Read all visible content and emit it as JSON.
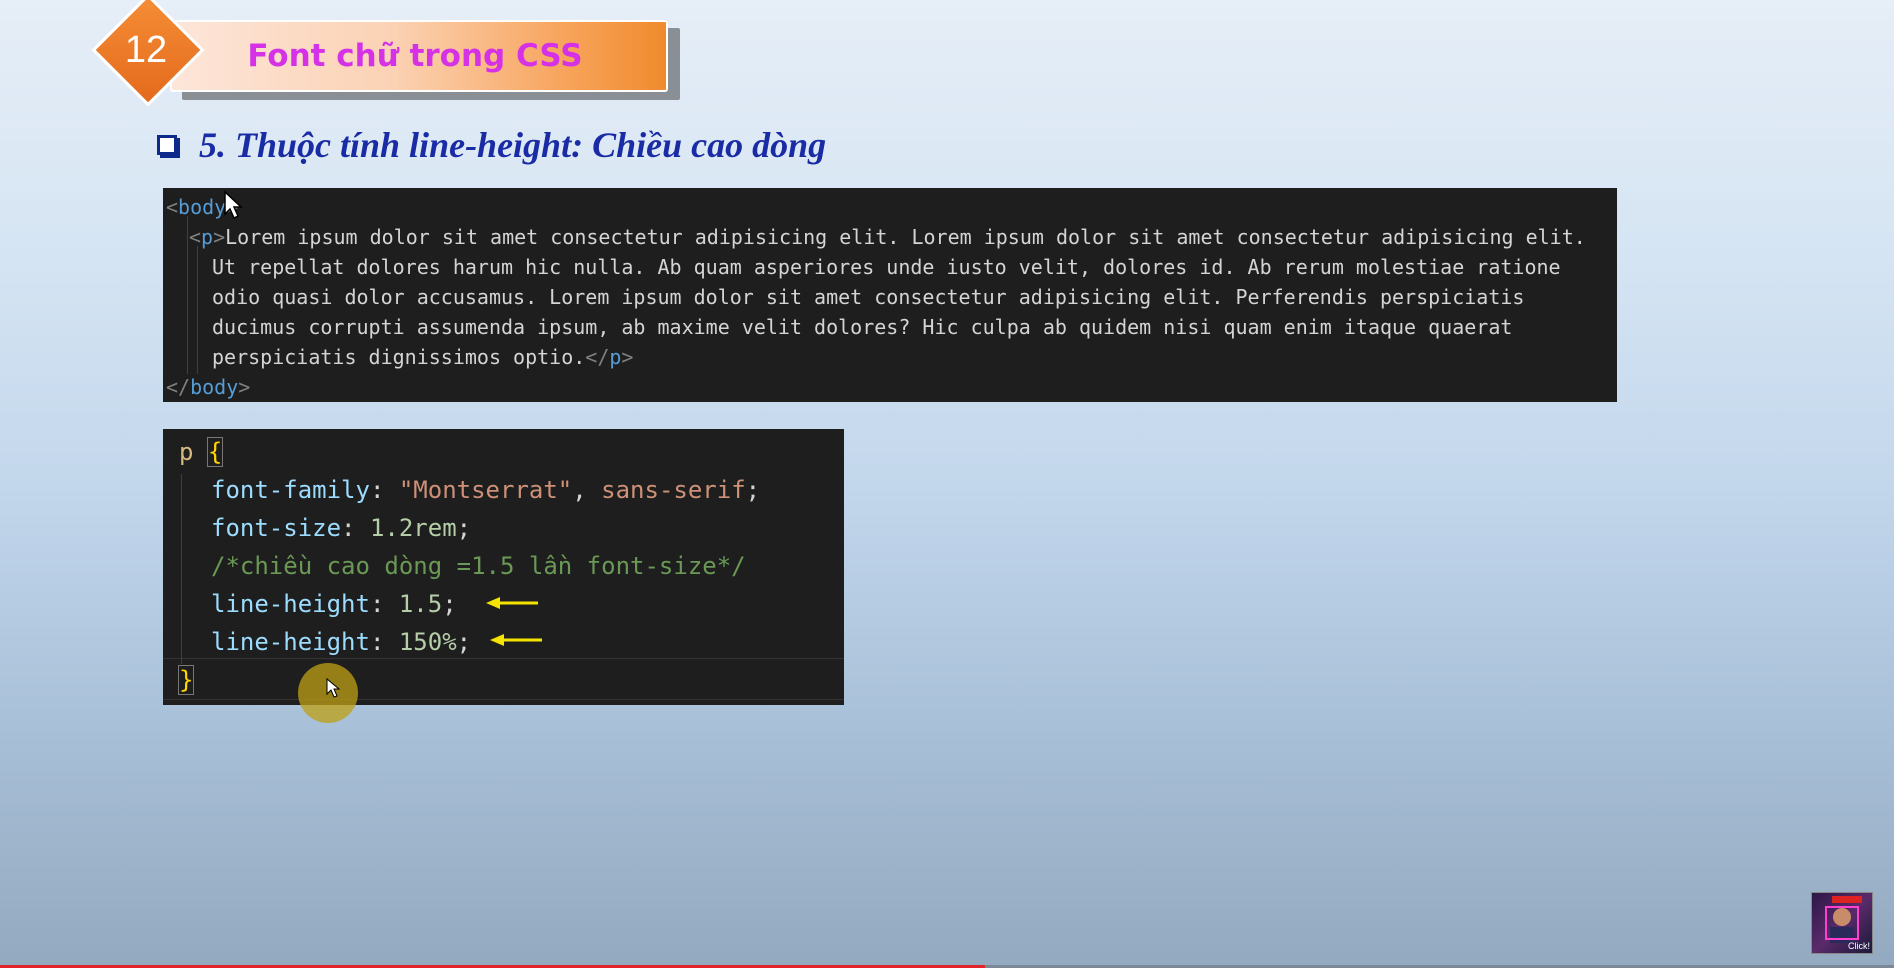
{
  "slide": {
    "badge_number": "12",
    "title": "Font chữ trong CSS",
    "heading": "5. Thuộc tính line-height: Chiều cao dòng"
  },
  "html_code": {
    "body_open_tag": "body",
    "p_open_tag": "p",
    "line1_text": "Lorem ipsum dolor sit amet consectetur adipisicing elit. Lorem ipsum dolor sit amet consectetur adipisicing elit.",
    "line2_text": "Ut repellat dolores harum hic nulla. Ab quam asperiores unde iusto velit, dolores id. Ab rerum molestiae ratione",
    "line3_text": "odio quasi dolor accusamus. Lorem ipsum dolor sit amet consectetur adipisicing elit. Perferendis perspiciatis",
    "line4_text": "ducimus corrupti assumenda ipsum, ab maxime velit dolores? Hic culpa ab quidem nisi quam enim itaque quaerat",
    "line5_text": "perspiciatis dignissimos optio.",
    "p_close_tag": "p",
    "body_close_tag": "body"
  },
  "css_code": {
    "selector": "p",
    "open_brace": "{",
    "close_brace": "}",
    "decl1_prop": "font-family",
    "decl1_value_str": "\"Montserrat\"",
    "decl1_value_rest": "sans-serif",
    "decl2_prop": "font-size",
    "decl2_value": "1.2rem",
    "comment": "/*chiều cao dòng =1.5 lần font-size*/",
    "decl3_prop": "line-height",
    "decl3_value": "1.5",
    "decl4_prop": "line-height",
    "decl4_value": "150%"
  },
  "colors": {
    "title": "#d531e6",
    "heading": "#1a2ca5",
    "arrow": "#f5e400",
    "progress": "#e0242a"
  },
  "video": {
    "progress_fraction": 0.52,
    "thumbnail_label": "Click!"
  }
}
